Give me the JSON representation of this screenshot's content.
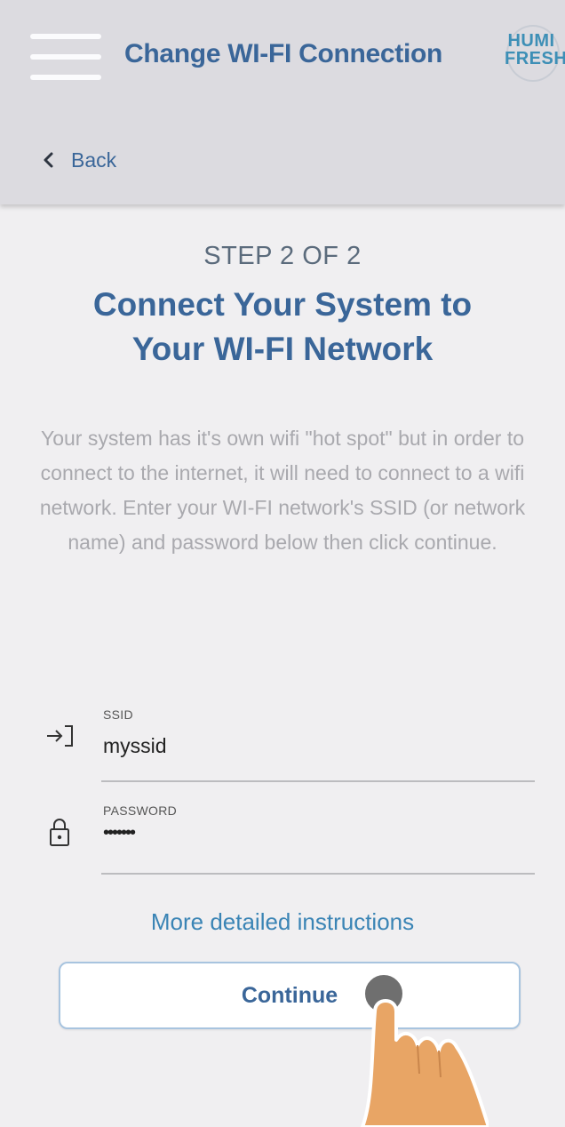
{
  "header": {
    "menu_icon": "hamburger-menu-icon",
    "title": "Change WI-FI Connection",
    "logo": {
      "line1": "HUMI",
      "line2": "FRESH"
    },
    "back_label": "Back",
    "background": "#dcdbe0",
    "title_color": "#3a6699"
  },
  "content": {
    "step": "STEP 2 OF 2",
    "title": "Connect Your System to Your WI-FI Network",
    "description": "Your system has it's own wifi \"hot spot\" but in order to connect to the internet, it will need to connect to a wifi network. Enter your WI-FI network's SSID (or network name) and password below then click continue."
  },
  "form": {
    "ssid": {
      "label": "SSID",
      "value": "myssid",
      "icon": "login-arrow-icon"
    },
    "password": {
      "label": "PASSWORD",
      "value": "•••••••",
      "icon": "lock-icon"
    }
  },
  "actions": {
    "more_instructions": "More detailed instructions",
    "continue": "Continue"
  },
  "overlay": {
    "icon": "pointing-hand-tap-icon"
  },
  "colors": {
    "accent": "#3a6699",
    "link": "#3a84b5",
    "page_bg": "#f0eff1"
  }
}
